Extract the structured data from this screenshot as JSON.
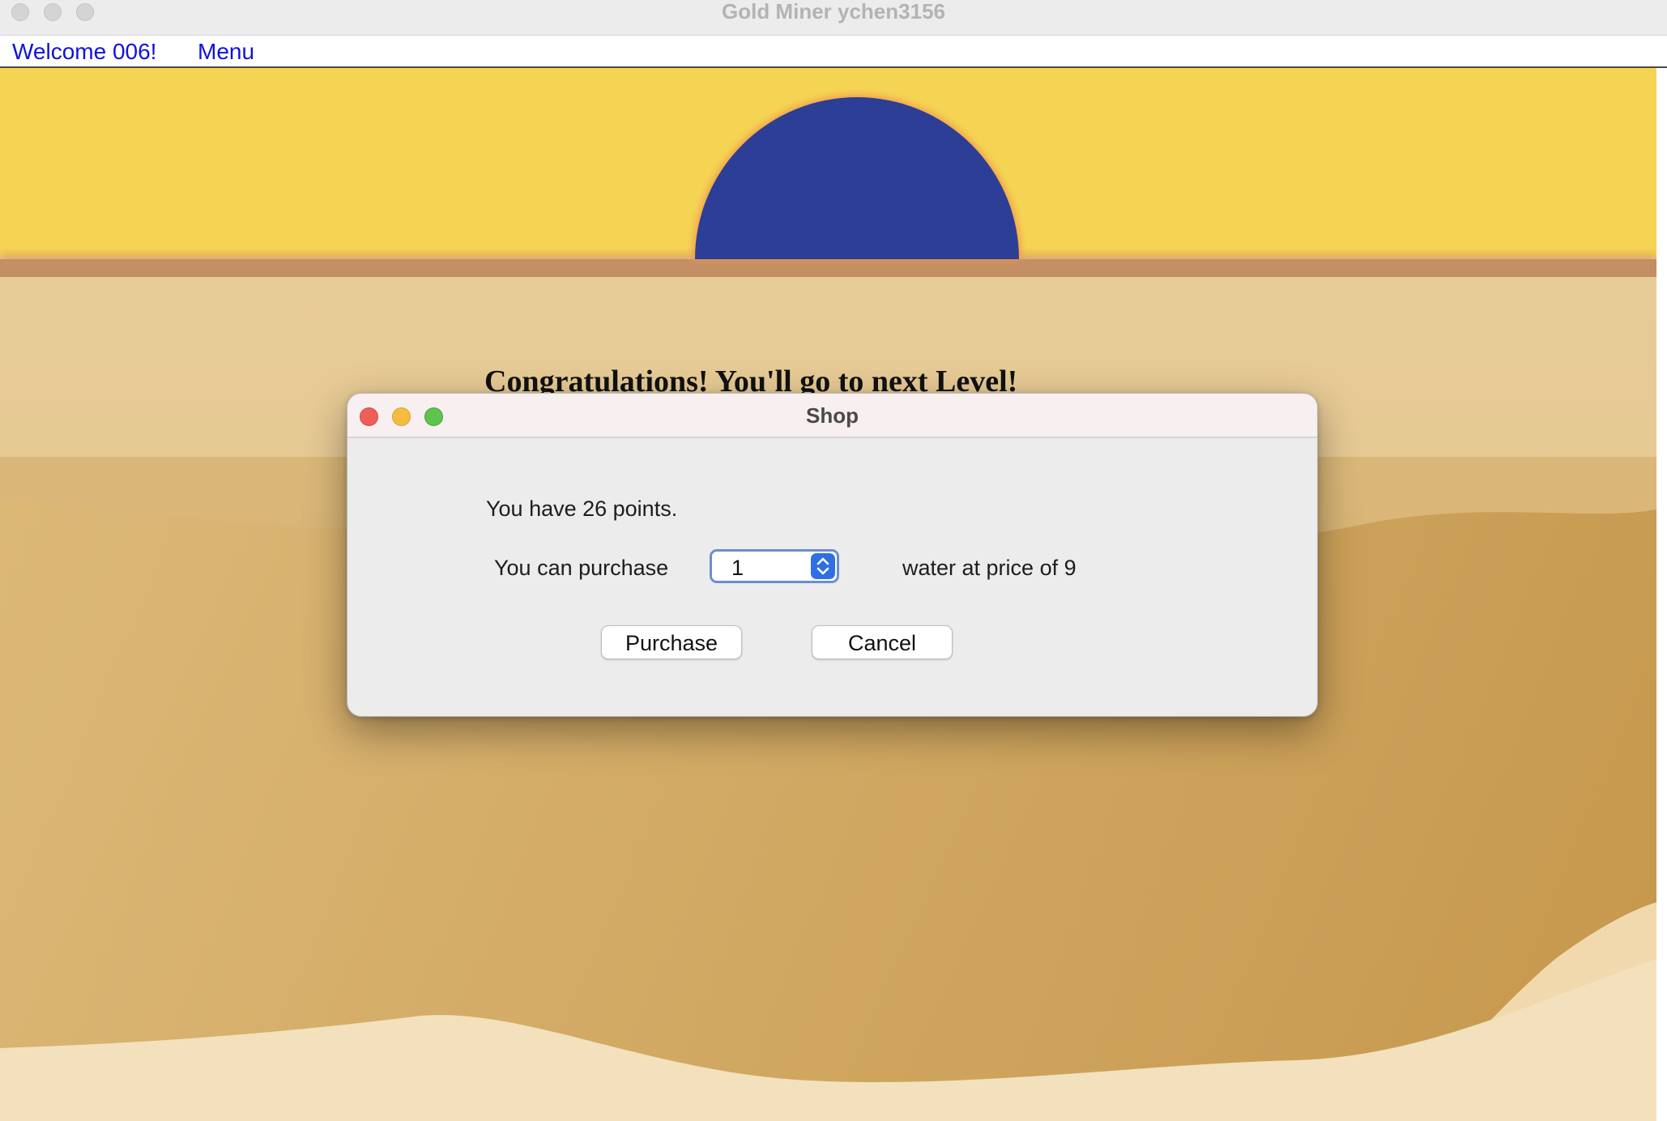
{
  "window": {
    "title": "Gold Miner ychen3156"
  },
  "menubar": {
    "welcome": "Welcome 006!",
    "menu": "Menu"
  },
  "canvas": {
    "congrats_text": "Congratulations! You'll go to next Level!",
    "sub_text": "(",
    "colors": {
      "sky": "#f5d454",
      "sun": "#2c3e95",
      "ground": "#d6b06b",
      "dune_light": "#f3dcb3"
    }
  },
  "dialog": {
    "title": "Shop",
    "points_text": "You have 26 points.",
    "purchase_label": "You can purchase",
    "quantity_value": "1",
    "item_text": "water at price of 9",
    "purchase_button": "Purchase",
    "cancel_button": "Cancel"
  }
}
